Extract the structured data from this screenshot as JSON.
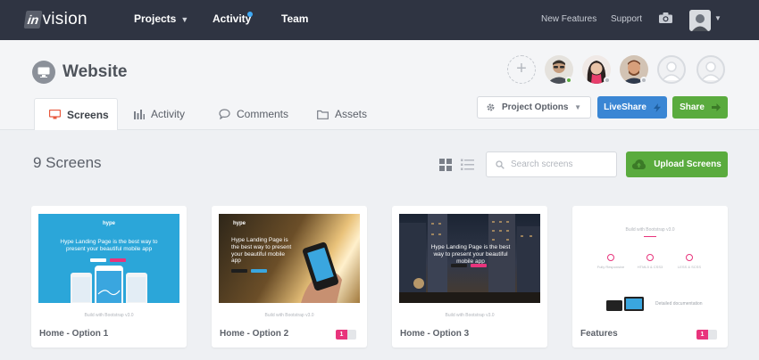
{
  "brand": {
    "logo_box": "in",
    "logo_rest": "vision"
  },
  "topnav": {
    "projects": "Projects",
    "activity": "Activity",
    "team": "Team",
    "new_features": "New Features",
    "support": "Support",
    "accent_dot": "#3fa9f5"
  },
  "project": {
    "title": "Website",
    "add_label": "+",
    "tabs": [
      {
        "label": "Screens",
        "icon": "monitor-icon",
        "active": true
      },
      {
        "label": "Activity",
        "icon": "bar-chart-icon"
      },
      {
        "label": "Comments",
        "icon": "speech-bubble-icon"
      },
      {
        "label": "Assets",
        "icon": "folder-icon"
      }
    ],
    "buttons": {
      "options": "Project Options",
      "liveshare": "LiveShare",
      "share": "Share"
    },
    "colors": {
      "liveshare": "#3a86d4",
      "share": "#5aab3e",
      "badge": "#e8347c"
    }
  },
  "toolbar": {
    "count": "9 Screens",
    "search_placeholder": "Search screens",
    "upload": "Upload Screens"
  },
  "screens": [
    {
      "name": "Home - Option 1",
      "thumb_caption": "Build with Bootstrap v3.0",
      "thumb_headline": "Hype Landing Page is the best way to present your beautiful mobile app",
      "comments": null
    },
    {
      "name": "Home - Option 2",
      "thumb_caption": "Build with Bootstrap v3.0",
      "thumb_headline": "Hype Landing Page is the best way to present your beautiful mobile app",
      "comments": "1"
    },
    {
      "name": "Home - Option 3",
      "thumb_caption": "Build with Bootstrap v3.0",
      "thumb_headline": "Hype Landing Page is the best way to present your beautiful mobile app",
      "comments": null
    },
    {
      "name": "Features",
      "thumb_caption": "",
      "thumb_headline": "Build with Bootstrap v3.0",
      "features": [
        "Fully Responsive",
        "HTML5 & CSS3",
        "LESS & SCSS"
      ],
      "feature_caption": "Detailed documentation",
      "comments": "1"
    }
  ]
}
